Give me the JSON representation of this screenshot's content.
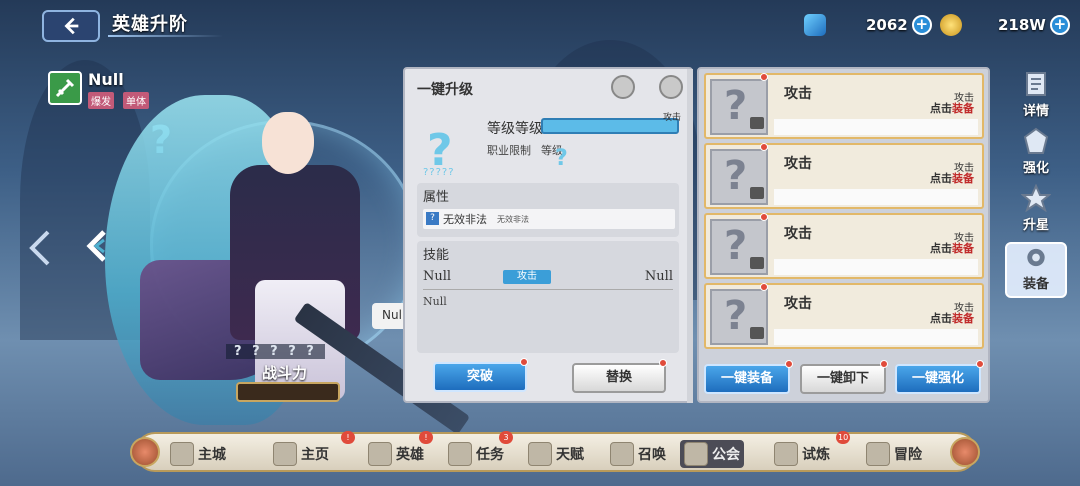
{
  "header": {
    "title": "英雄升阶",
    "resources": [
      {
        "name": "gem",
        "value": "2062"
      },
      {
        "name": "gold",
        "value": "218W"
      }
    ]
  },
  "hero": {
    "name": "Null",
    "tags": [
      "爆发",
      "单体"
    ],
    "unknown_mark": "?",
    "bubble_text": "Null",
    "stars_text": "? ? ? ? ?",
    "power_label": "战斗力"
  },
  "upgrade_panel": {
    "title": "一键升级",
    "item_mark": "?",
    "item_marks_small": "?????",
    "level_label": "等级等级.",
    "level_note": "攻击",
    "job_label": "职业限制",
    "job_level_label": "等级",
    "job_mark": "?",
    "attr_section_title": "属性",
    "attr_icon": "?",
    "attr_name": "无效非法",
    "attr_sub": "无效非法",
    "skill_section_title": "技能",
    "skill_name_left": "Null",
    "skill_badge": "攻击",
    "skill_name_right": "Null",
    "skill_desc": "Null",
    "breakthrough_label": "突破",
    "replace_label": "替换"
  },
  "equipment": {
    "slots": [
      {
        "mark": "?",
        "title": "攻击",
        "type": "攻击",
        "tap_prefix": "点击",
        "tap_action": "装备"
      },
      {
        "mark": "?",
        "title": "攻击",
        "type": "攻击",
        "tap_prefix": "点击",
        "tap_action": "装备"
      },
      {
        "mark": "?",
        "title": "攻击",
        "type": "攻击",
        "tap_prefix": "点击",
        "tap_action": "装备"
      },
      {
        "mark": "?",
        "title": "攻击",
        "type": "攻击",
        "tap_prefix": "点击",
        "tap_action": "装备"
      }
    ],
    "equip_all_label": "一键装备",
    "unequip_all_label": "一键卸下",
    "enhance_all_label": "一键强化"
  },
  "side_tabs": [
    {
      "label": "详情",
      "icon": "scroll-icon"
    },
    {
      "label": "强化",
      "icon": "emblem-icon"
    },
    {
      "label": "升星",
      "icon": "star-icon"
    },
    {
      "label": "装备",
      "icon": "gear-icon"
    }
  ],
  "bottom_nav": [
    {
      "label": "主城",
      "badge": ""
    },
    {
      "label": "主页",
      "badge": "!"
    },
    {
      "label": "英雄",
      "badge": "!"
    },
    {
      "label": "任务",
      "badge": "3"
    },
    {
      "label": "天赋",
      "badge": ""
    },
    {
      "label": "召唤",
      "badge": ""
    },
    {
      "label": "公会",
      "badge": ""
    },
    {
      "label": "试炼",
      "badge": "10"
    },
    {
      "label": "冒险",
      "badge": ""
    }
  ],
  "colors": {
    "accent_blue": "#2a8ed8",
    "badge_red": "#e04b3b",
    "gold_border": "#e2b868"
  }
}
